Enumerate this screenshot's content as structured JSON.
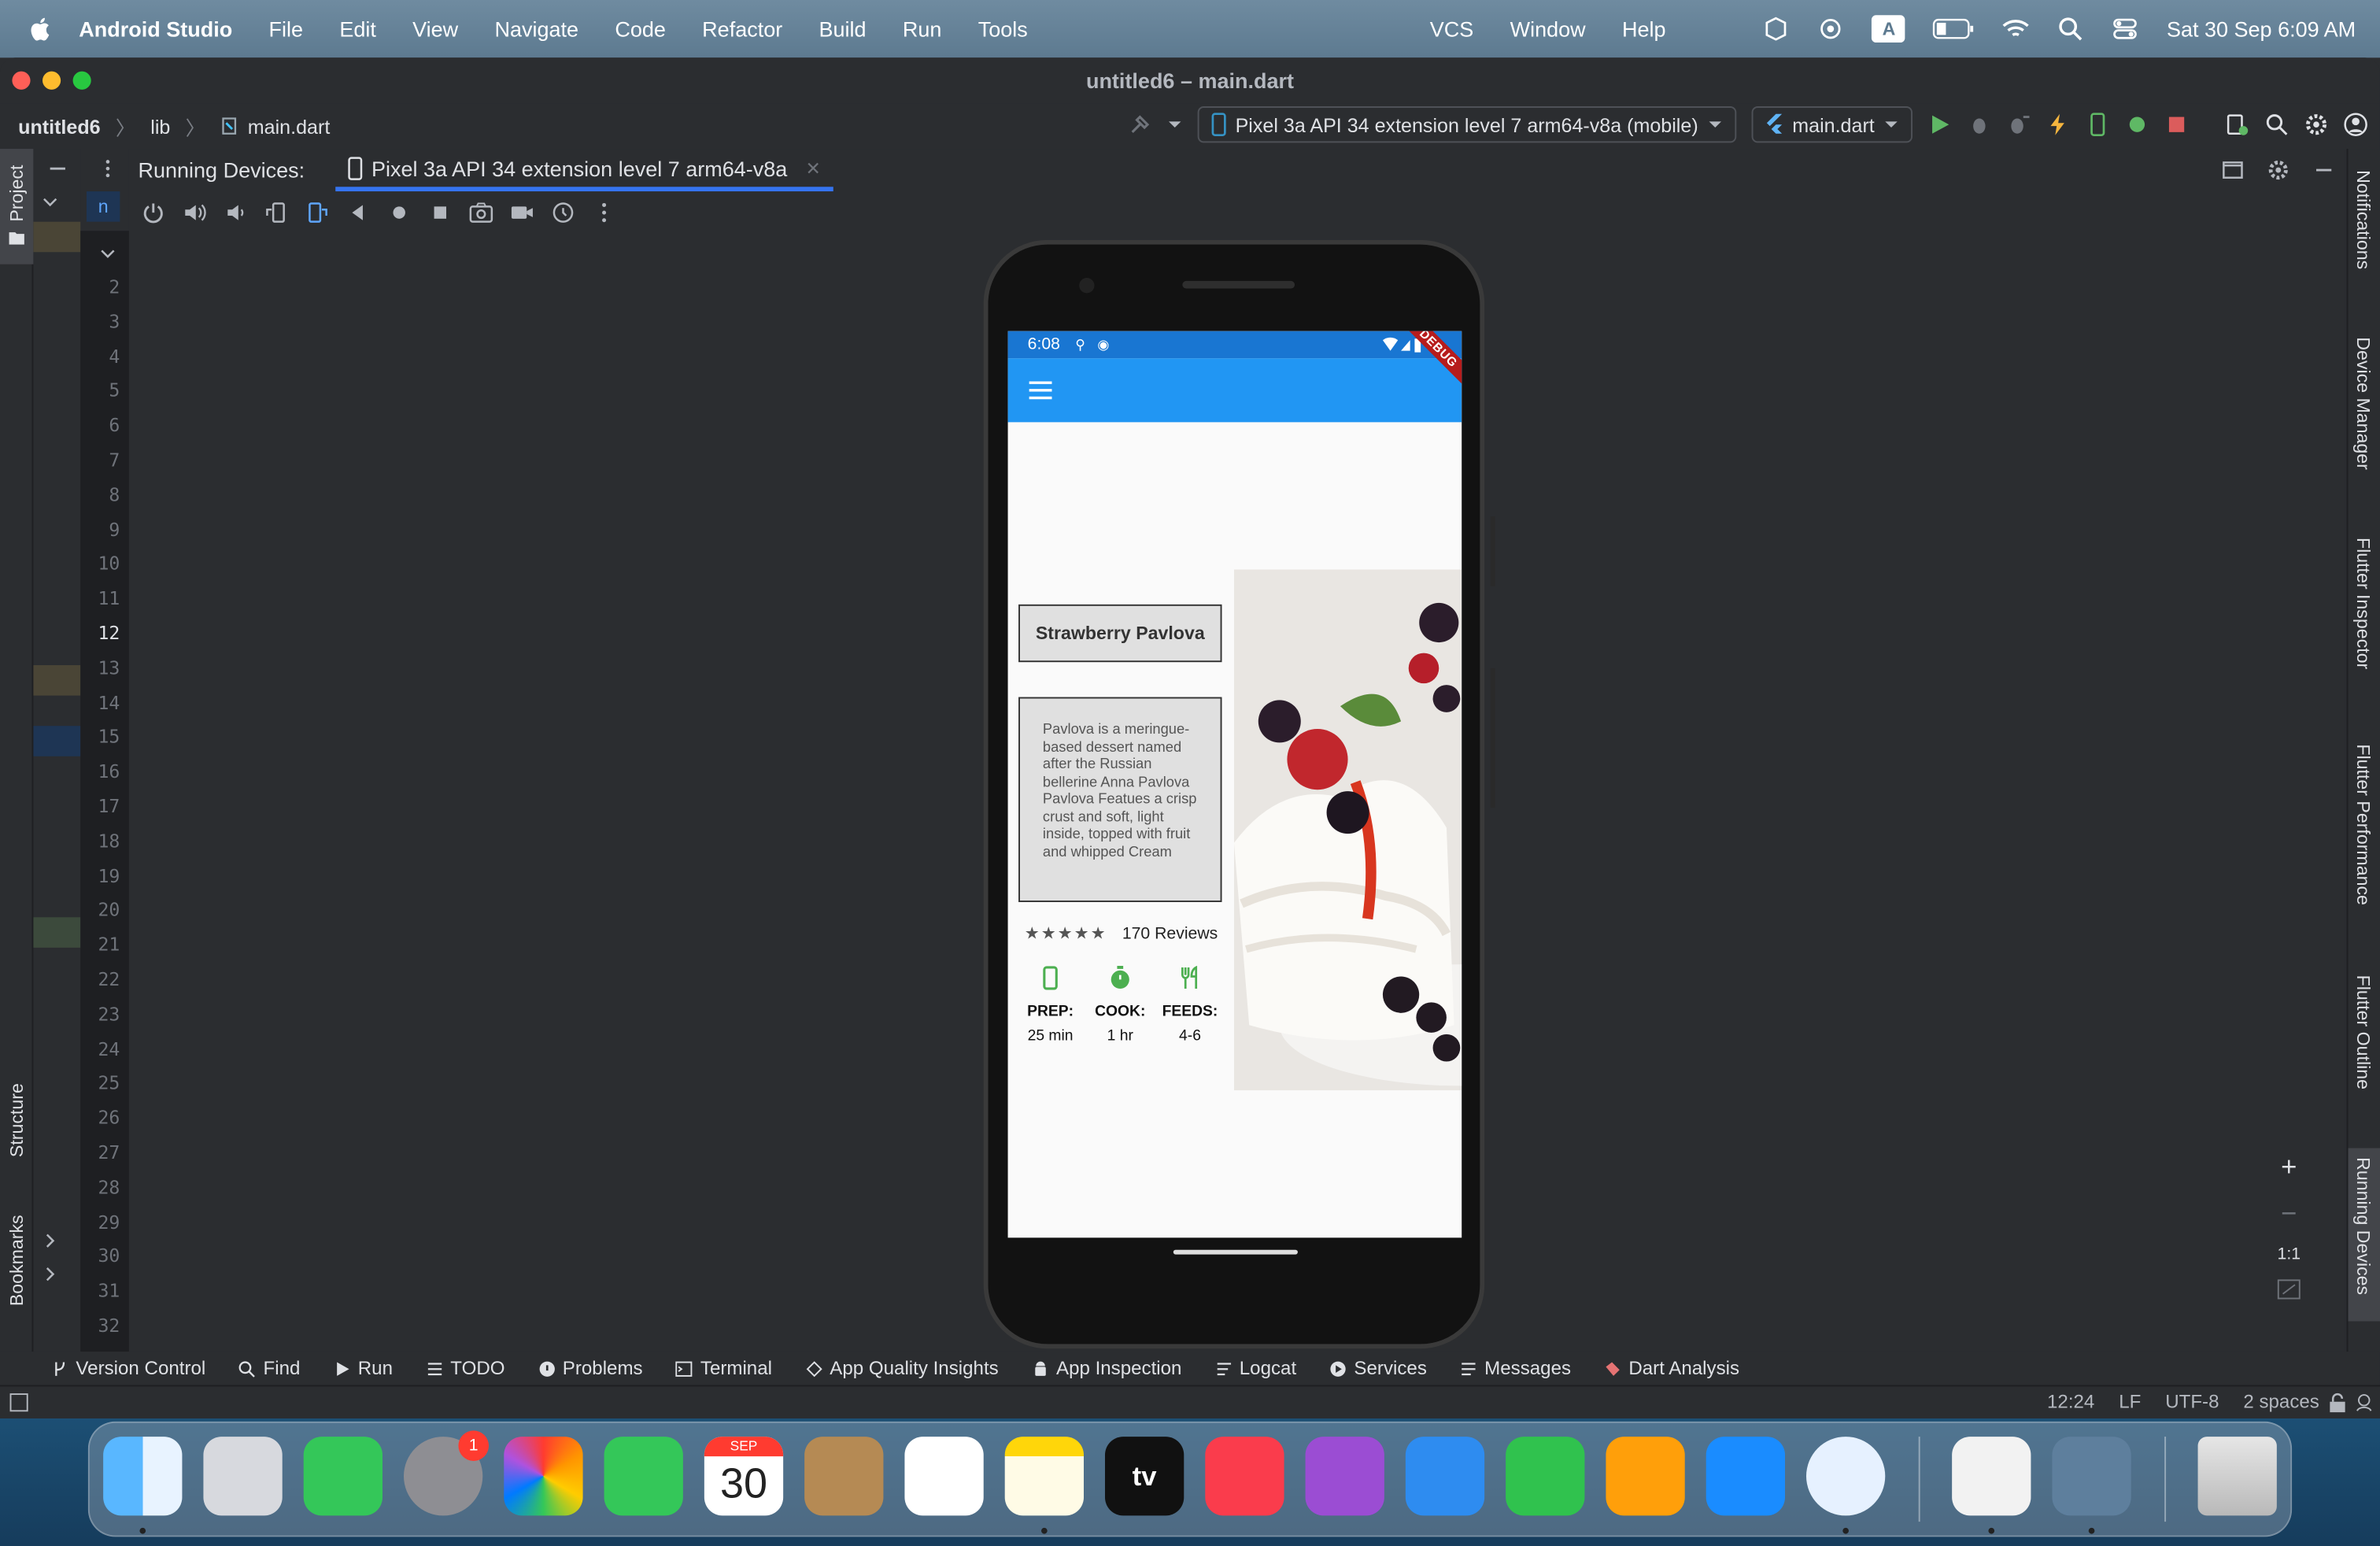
{
  "menubar": {
    "app_name": "Android Studio",
    "items": [
      "File",
      "Edit",
      "View",
      "Navigate",
      "Code",
      "Refactor",
      "Build",
      "Run",
      "Tools",
      "VCS",
      "Window",
      "Help"
    ],
    "input_source": "A",
    "datetime": "Sat 30 Sep  6:09 AM"
  },
  "window": {
    "title": "untitled6 – main.dart"
  },
  "breadcrumb": {
    "project": "untitled6",
    "folder": "lib",
    "file": "main.dart"
  },
  "toolbar": {
    "device_selector": "Pixel 3a API 34 extension level 7 arm64-v8a (mobile)",
    "run_config": "main.dart"
  },
  "left_stripe": {
    "project": "Project",
    "structure": "Structure",
    "bookmarks": "Bookmarks"
  },
  "right_stripe": {
    "notifications": "Notifications",
    "device_manager": "Device Manager",
    "flutter_inspector": "Flutter Inspector",
    "flutter_performance": "Flutter Performance",
    "flutter_outline": "Flutter Outline",
    "running_devices": "Running Devices"
  },
  "running_devices": {
    "label": "Running Devices:",
    "tab": "Pixel 3a API 34 extension level 7 arm64-v8a"
  },
  "line_numbers": [
    "2",
    "3",
    "4",
    "5",
    "6",
    "7",
    "8",
    "9",
    "10",
    "11",
    "12",
    "13",
    "14",
    "15",
    "16",
    "17",
    "18",
    "19",
    "20",
    "21",
    "22",
    "23",
    "24",
    "25",
    "26",
    "27",
    "28",
    "29",
    "30",
    "31",
    "32"
  ],
  "current_line": "12",
  "emulator": {
    "status_time": "6:08",
    "debug_banner": "DEBUG",
    "recipe_title": "Strawberry Pavlova",
    "description": "Pavlova is a meringue-based dessert named after the Russian bellerine Anna Pavlova Pavlova Featues a crisp crust and soft, light inside, topped with fruit and whipped Cream",
    "stars": "★★★★★",
    "reviews": "170 Reviews",
    "prep_label": "PREP:",
    "prep_value": "25 min",
    "cook_label": "COOK:",
    "cook_value": "1 hr",
    "feeds_label": "FEEDS:",
    "feeds_value": "4-6"
  },
  "zoom": {
    "plus": "+",
    "minus": "−",
    "actual": "1:1"
  },
  "bottom_tools": [
    "Version Control",
    "Find",
    "Run",
    "TODO",
    "Problems",
    "Terminal",
    "App Quality Insights",
    "App Inspection",
    "Logcat",
    "Services",
    "Messages",
    "Dart Analysis"
  ],
  "status": {
    "position": "12:24",
    "line_sep": "LF",
    "encoding": "UTF-8",
    "indent": "2 spaces"
  },
  "dock": {
    "calendar_month": "SEP",
    "calendar_day": "30",
    "settings_badge": "1",
    "tv_label": "tv"
  },
  "colors": {
    "ide_bg": "#2b2d30",
    "accent": "#3574f0",
    "app_bar": "#2196f3",
    "icon_green": "#4caf50"
  }
}
